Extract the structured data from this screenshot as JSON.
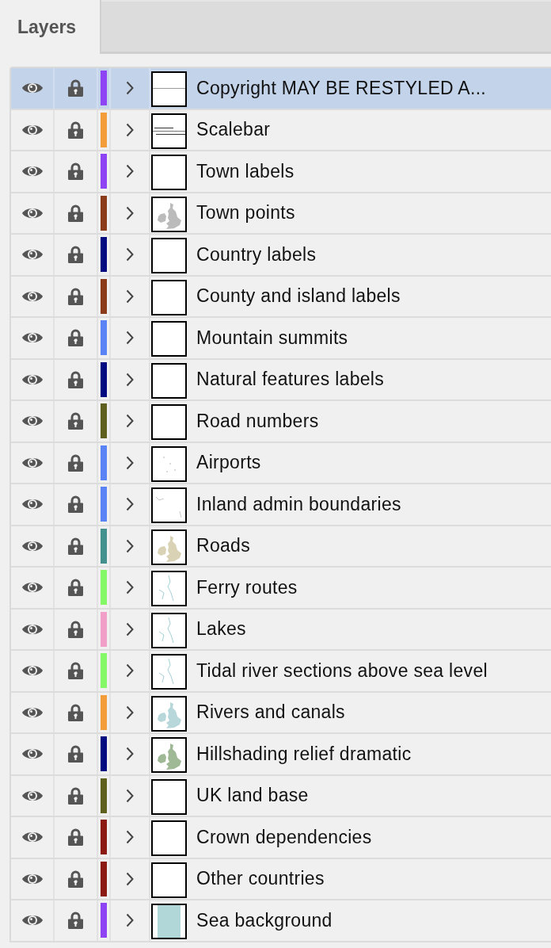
{
  "tabs": [
    {
      "label": "Layers",
      "selected": true
    }
  ],
  "layers": [
    {
      "name": "Copyright MAY BE RESTYLED A...",
      "selected": true,
      "color": "#8e44f5",
      "kind": "line"
    },
    {
      "name": "Scalebar",
      "selected": false,
      "color": "#f39c3a",
      "kind": "scale"
    },
    {
      "name": "Town labels",
      "selected": false,
      "color": "#8e44f5",
      "kind": "blank"
    },
    {
      "name": "Town points",
      "selected": false,
      "color": "#8b3a1a",
      "kind": "mapgray"
    },
    {
      "name": "Country labels",
      "selected": false,
      "color": "#000a80",
      "kind": "blank"
    },
    {
      "name": "County and island labels",
      "selected": false,
      "color": "#8b3a1a",
      "kind": "blank"
    },
    {
      "name": "Mountain summits",
      "selected": false,
      "color": "#5a83f5",
      "kind": "blank"
    },
    {
      "name": "Natural features labels",
      "selected": false,
      "color": "#000a80",
      "kind": "blank"
    },
    {
      "name": "Road numbers",
      "selected": false,
      "color": "#5f5f1e",
      "kind": "blank"
    },
    {
      "name": "Airports",
      "selected": false,
      "color": "#5a83f5",
      "kind": "specks"
    },
    {
      "name": "Inland admin boundaries",
      "selected": false,
      "color": "#5a83f5",
      "kind": "lines"
    },
    {
      "name": "Roads",
      "selected": false,
      "color": "#42918f",
      "kind": "mapbeige"
    },
    {
      "name": "Ferry routes",
      "selected": false,
      "color": "#84f866",
      "kind": "water"
    },
    {
      "name": "Lakes",
      "selected": false,
      "color": "#f19ec8",
      "kind": "water"
    },
    {
      "name": "Tidal river sections above sea level",
      "selected": false,
      "color": "#84f866",
      "kind": "water"
    },
    {
      "name": "Rivers and canals",
      "selected": false,
      "color": "#f39c3a",
      "kind": "mapblue"
    },
    {
      "name": "Hillshading relief dramatic",
      "selected": false,
      "color": "#000a80",
      "kind": "mapgreen"
    },
    {
      "name": "UK land base",
      "selected": false,
      "color": "#5f5f1e",
      "kind": "blank"
    },
    {
      "name": "Crown dependencies",
      "selected": false,
      "color": "#8b1a12",
      "kind": "blank"
    },
    {
      "name": "Other countries",
      "selected": false,
      "color": "#8b1a12",
      "kind": "blank"
    },
    {
      "name": "Sea background",
      "selected": false,
      "color": "#8e44f5",
      "kind": "fill"
    }
  ]
}
